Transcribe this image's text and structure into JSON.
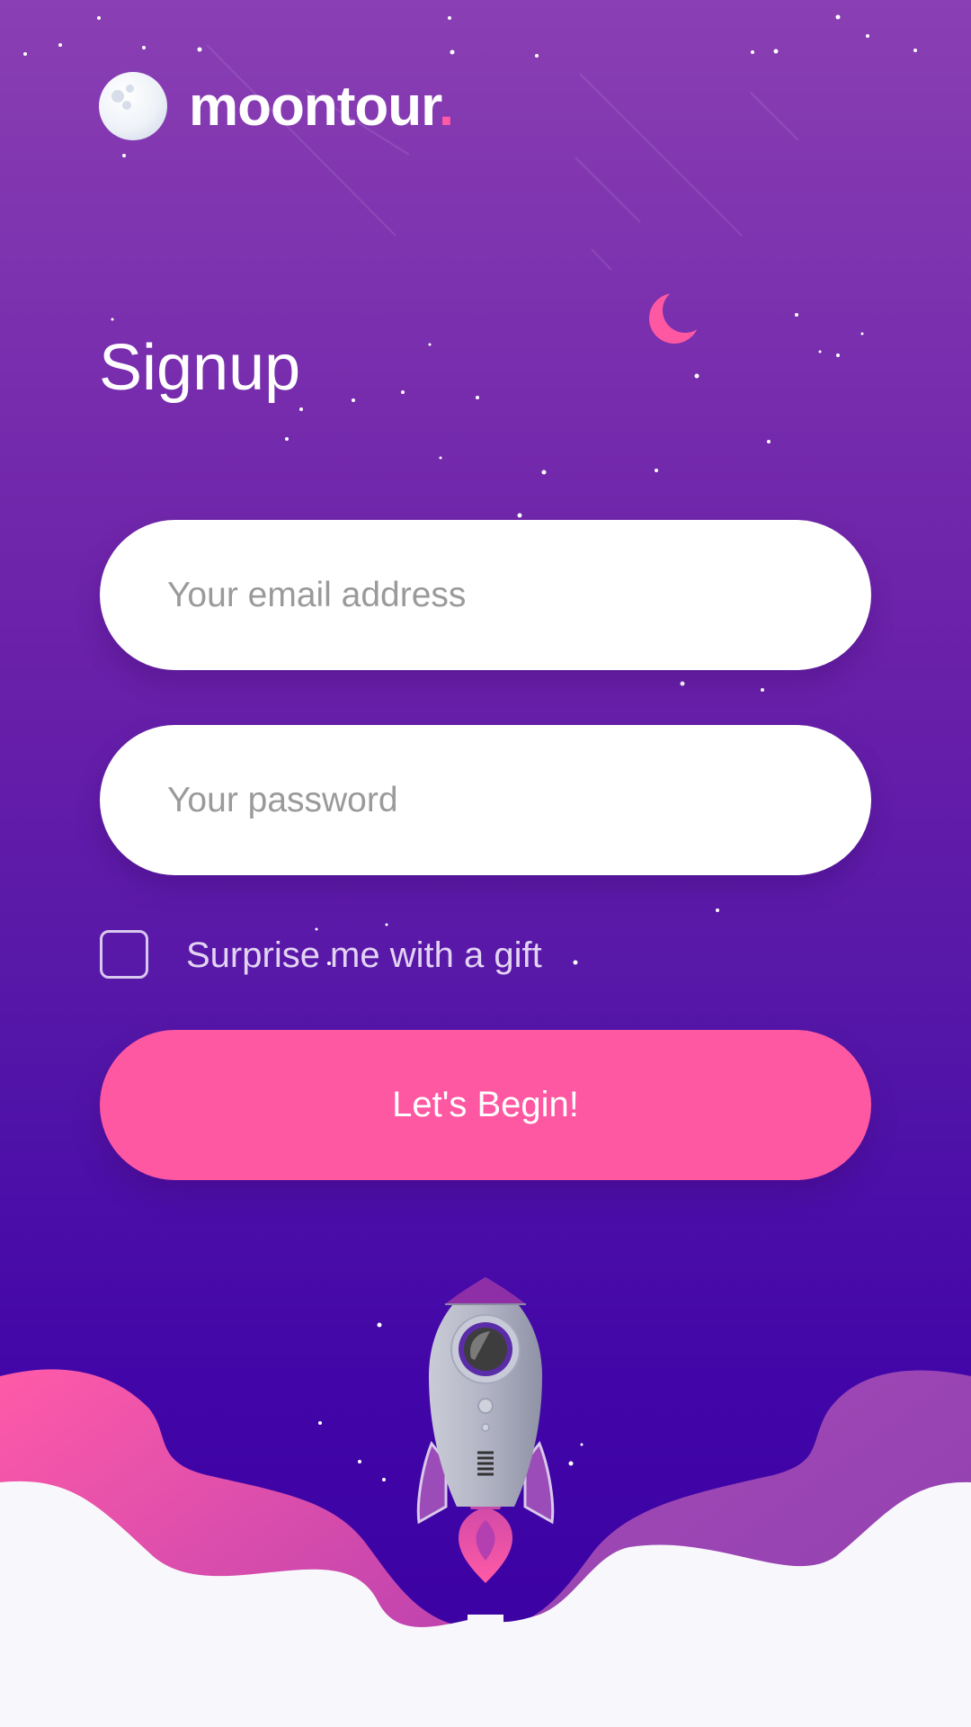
{
  "brand": {
    "name": "moontour",
    "dot": "."
  },
  "title": "Signup",
  "form": {
    "email_placeholder": "Your email address",
    "password_placeholder": "Your password",
    "gift_label": "Surprise me with a gift",
    "submit_label": "Let's Begin!"
  },
  "colors": {
    "accent_pink": "#ff58a2",
    "bg_top": "#8a3fb3",
    "bg_bottom": "#3a00a0",
    "ground": "#f8f8fc"
  },
  "icons": [
    "moon-logo-icon",
    "crescent-moon-icon",
    "rocket-illustration"
  ]
}
